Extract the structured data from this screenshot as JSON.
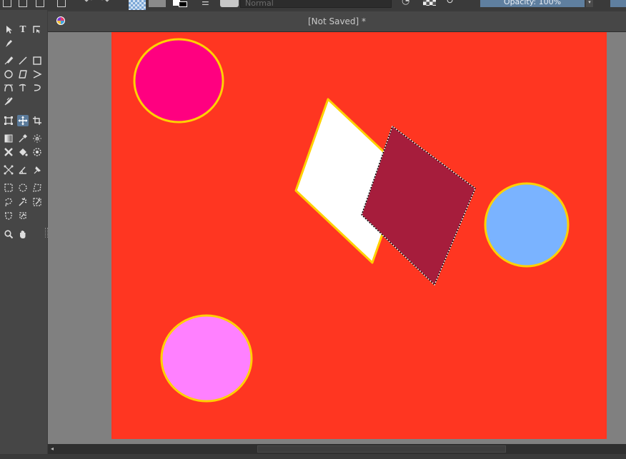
{
  "toolbar": {
    "blend_mode": "Normal",
    "opacity_label": "Opacity: 100%"
  },
  "document": {
    "tab_title": "[Not Saved]  *"
  },
  "canvas": {
    "background_color": "#ff3621",
    "shapes": [
      {
        "type": "circle",
        "name": "pink-circle",
        "fill": "#ff0080",
        "stroke": "#ffd000"
      },
      {
        "type": "quad",
        "name": "white-rhombus",
        "fill": "#ffffff",
        "stroke": "#ffd000"
      },
      {
        "type": "quad",
        "name": "maroon-rhombus-selected",
        "fill": "#a61d3c",
        "stroke": "#ffffff",
        "selected": true
      },
      {
        "type": "circle",
        "name": "blue-circle",
        "fill": "#7ab3ff",
        "stroke": "#ffd000"
      },
      {
        "type": "circle",
        "name": "violet-circle",
        "fill": "#ff80ff",
        "stroke": "#ffd000"
      }
    ]
  },
  "toolbox": {
    "tools": [
      "select-shape-tool",
      "text-tool",
      "edit-shapes-tool",
      "calligraphy-tool",
      "freehand-brush-tool",
      "line-tool",
      "rectangle-tool",
      "ellipse-tool",
      "polygon-tool",
      "polyline-tool",
      "bezier-tool",
      "freehand-path-tool",
      "dynamic-brush-tool",
      "multibrush-tool",
      "transform-tool",
      "move-tool",
      "crop-tool",
      "gradient-tool",
      "color-picker-tool",
      "colorize-mask-tool",
      "smart-patch-tool",
      "fill-tool",
      "enclose-fill-tool",
      "assistant-tool",
      "measure-tool",
      "reference-images-tool",
      "rectangular-selection-tool",
      "elliptical-selection-tool",
      "polygonal-selection-tool",
      "freehand-selection-tool",
      "contiguous-selection-tool",
      "similar-selection-tool",
      "bezier-selection-tool",
      "magnetic-selection-tool",
      "zoom-tool",
      "pan-tool"
    ]
  }
}
